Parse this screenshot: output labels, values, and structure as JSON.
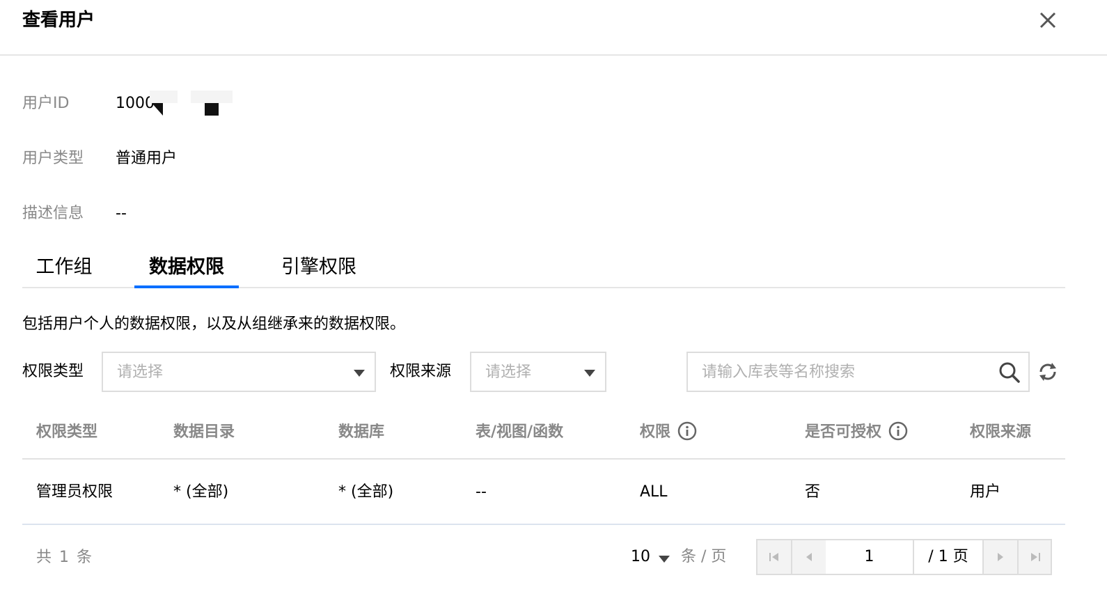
{
  "dialog": {
    "title": "查看用户",
    "close_icon": "close-icon"
  },
  "user_info": {
    "id_label": "用户ID",
    "id_value": "1000",
    "type_label": "用户类型",
    "type_value": "普通用户",
    "desc_label": "描述信息",
    "desc_value": "--"
  },
  "tabs": [
    {
      "label": "工作组",
      "active": false
    },
    {
      "label": "数据权限",
      "active": true
    },
    {
      "label": "引擎权限",
      "active": false
    }
  ],
  "description": "包括用户个人的数据权限，以及从组继承来的数据权限。",
  "filters": {
    "perm_type_label": "权限类型",
    "perm_type_placeholder": "请选择",
    "perm_source_label": "权限来源",
    "perm_source_placeholder": "请选择",
    "search_placeholder": "请输入库表等名称搜索",
    "search_icon": "search-icon",
    "refresh_icon": "refresh-icon"
  },
  "table": {
    "columns": [
      "权限类型",
      "数据目录",
      "数据库",
      "表/视图/函数",
      "权限",
      "是否可授权",
      "权限来源"
    ],
    "rows": [
      [
        "管理员权限",
        "* (全部)",
        "* (全部)",
        "--",
        "ALL",
        "否",
        "用户"
      ]
    ]
  },
  "pagination": {
    "total_text": "共 1 条",
    "page_size": "10",
    "per_page_text": "条 / 页",
    "current_page": "1",
    "total_pages_text": "/ 1 页"
  },
  "colors": {
    "accent": "#006eff",
    "muted_text": "#888888",
    "border": "#dddddd"
  }
}
